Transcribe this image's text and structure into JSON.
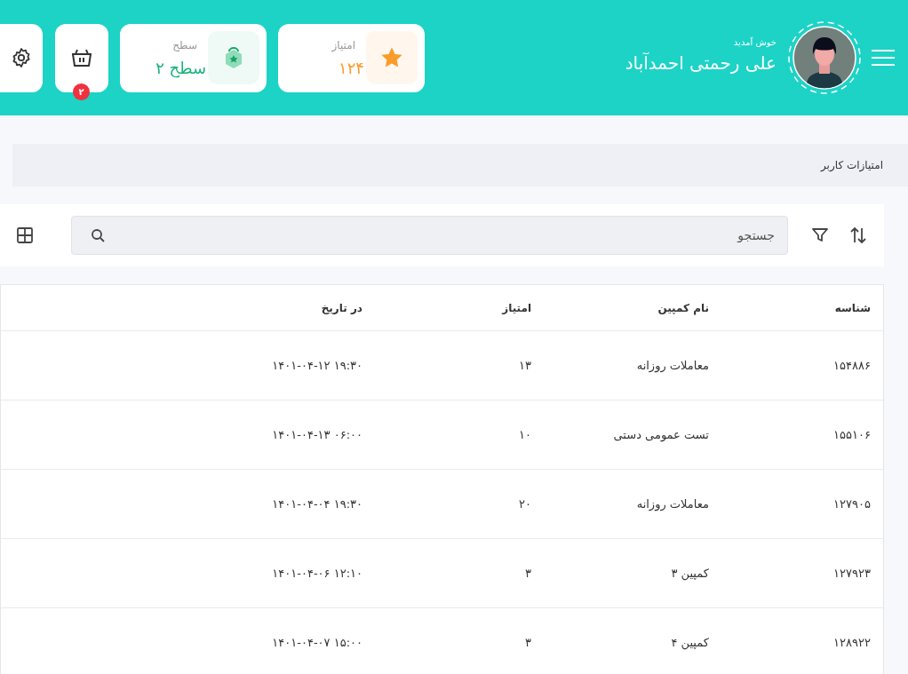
{
  "header": {
    "welcome": "خوش آمدید",
    "user_name": "علی رحمتی احمدآباد",
    "stats": [
      {
        "kind": "points",
        "label": "امتیاز",
        "value": "۱۲۴"
      },
      {
        "kind": "level",
        "label": "سطح",
        "value": "سطح ۲"
      }
    ],
    "cart_badge": "۲"
  },
  "breadcrumb": "امتیازات کاربر",
  "search": {
    "placeholder": "جستجو"
  },
  "table": {
    "columns": [
      "شناسه",
      "نام کمپین",
      "امتیاز",
      "در تاریخ"
    ],
    "rows": [
      [
        "۱۵۴۸۸۶",
        "معاملات روزانه",
        "۱۳",
        "۱۴۰۱-۰۴-۱۲ ۱۹:۳۰"
      ],
      [
        "۱۵۵۱۰۶",
        "تست عمومی دستی",
        "۱۰",
        "۱۴۰۱-۰۴-۱۳ ۰۶:۰۰"
      ],
      [
        "۱۲۷۹۰۵",
        "معاملات روزانه",
        "۲۰",
        "۱۴۰۱-۰۴-۰۴ ۱۹:۳۰"
      ],
      [
        "۱۲۷۹۲۳",
        "کمپین ۳",
        "۳",
        "۱۴۰۱-۰۴-۰۶ ۱۲:۱۰"
      ],
      [
        "۱۲۸۹۲۲",
        "کمپین ۴",
        "۳",
        "۱۴۰۱-۰۴-۰۷ ۱۵:۰۰"
      ]
    ]
  }
}
